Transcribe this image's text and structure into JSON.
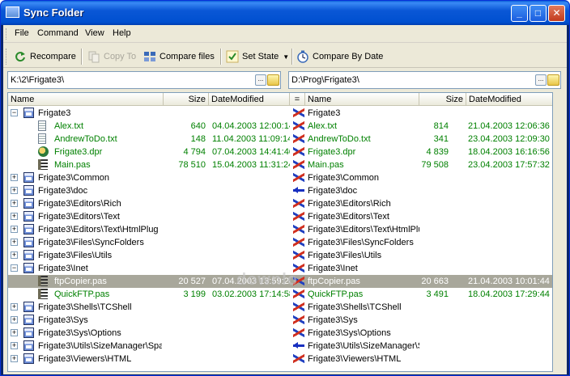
{
  "window": {
    "title": "Sync Folder",
    "buttons": {
      "minimize": "_",
      "maximize": "□",
      "close": "✕"
    }
  },
  "menu": [
    "File",
    "Command",
    "View",
    "Help"
  ],
  "toolbar": {
    "recompare": "Recompare",
    "copy_to": "Copy To",
    "compare_files": "Compare files",
    "set_state": "Set State",
    "compare_by_date": "Compare By Date"
  },
  "left_path": "K:\\2\\Frigate3\\",
  "right_path": "D:\\Prog\\Frigate3\\",
  "path_button": "...",
  "columns": {
    "left_name": "Name",
    "left_size": "Size",
    "left_date": "DateModified",
    "state": "=",
    "right_name": "Name",
    "right_size": "Size",
    "right_date": "DateModified"
  },
  "rows": [
    {
      "level": 0,
      "exp": "−",
      "icon": "dir",
      "name": "Frigate3",
      "size": "",
      "date": "",
      "sync": "swap",
      "rname": "Frigate3",
      "rsize": "",
      "rdate": "",
      "green": false,
      "sel": false
    },
    {
      "level": 1,
      "exp": "",
      "icon": "txt",
      "name": "Alex.txt",
      "size": "640",
      "date": "04.04.2003 12:00:14",
      "sync": "swap",
      "rname": "Alex.txt",
      "rsize": "814",
      "rdate": "21.04.2003 12:06:36",
      "green": true,
      "sel": false
    },
    {
      "level": 1,
      "exp": "",
      "icon": "txt",
      "name": "AndrewToDo.txt",
      "size": "148",
      "date": "11.04.2003 11:09:14",
      "sync": "swap",
      "rname": "AndrewToDo.txt",
      "rsize": "341",
      "rdate": "23.04.2003 12:09:30",
      "green": true,
      "sel": false
    },
    {
      "level": 1,
      "exp": "",
      "icon": "dpr",
      "name": "Frigate3.dpr",
      "size": "4 794",
      "date": "07.04.2003 14:41:46",
      "sync": "swap",
      "rname": "Frigate3.dpr",
      "rsize": "4 839",
      "rdate": "18.04.2003 16:16:56",
      "green": true,
      "sel": false
    },
    {
      "level": 1,
      "exp": "",
      "icon": "pas",
      "name": "Main.pas",
      "size": "78 510",
      "date": "15.04.2003 11:31:24",
      "sync": "swap",
      "rname": "Main.pas",
      "rsize": "79 508",
      "rdate": "23.04.2003 17:57:32",
      "green": true,
      "sel": false
    },
    {
      "level": 0,
      "exp": "+",
      "icon": "dir",
      "name": "Frigate3\\Common",
      "size": "",
      "date": "",
      "sync": "swap",
      "rname": "Frigate3\\Common",
      "rsize": "",
      "rdate": "",
      "green": false,
      "sel": false
    },
    {
      "level": 0,
      "exp": "+",
      "icon": "dir",
      "name": "Frigate3\\doc",
      "size": "",
      "date": "",
      "sync": "left",
      "rname": "Frigate3\\doc",
      "rsize": "",
      "rdate": "",
      "green": false,
      "sel": false
    },
    {
      "level": 0,
      "exp": "+",
      "icon": "dir",
      "name": "Frigate3\\Editors\\Rich",
      "size": "",
      "date": "",
      "sync": "swap",
      "rname": "Frigate3\\Editors\\Rich",
      "rsize": "",
      "rdate": "",
      "green": false,
      "sel": false
    },
    {
      "level": 0,
      "exp": "+",
      "icon": "dir",
      "name": "Frigate3\\Editors\\Text",
      "size": "",
      "date": "",
      "sync": "swap",
      "rname": "Frigate3\\Editors\\Text",
      "rsize": "",
      "rdate": "",
      "green": false,
      "sel": false
    },
    {
      "level": 0,
      "exp": "+",
      "icon": "dir",
      "name": "Frigate3\\Editors\\Text\\HtmlPlug",
      "size": "",
      "date": "",
      "sync": "swap",
      "rname": "Frigate3\\Editors\\Text\\HtmlPlug",
      "rsize": "",
      "rdate": "",
      "green": false,
      "sel": false
    },
    {
      "level": 0,
      "exp": "+",
      "icon": "dir",
      "name": "Frigate3\\Files\\SyncFolders",
      "size": "",
      "date": "",
      "sync": "swap",
      "rname": "Frigate3\\Files\\SyncFolders",
      "rsize": "",
      "rdate": "",
      "green": false,
      "sel": false
    },
    {
      "level": 0,
      "exp": "+",
      "icon": "dir",
      "name": "Frigate3\\Files\\Utils",
      "size": "",
      "date": "",
      "sync": "swap",
      "rname": "Frigate3\\Files\\Utils",
      "rsize": "",
      "rdate": "",
      "green": false,
      "sel": false
    },
    {
      "level": 0,
      "exp": "−",
      "icon": "dir",
      "name": "Frigate3\\Inet",
      "size": "",
      "date": "",
      "sync": "swap",
      "rname": "Frigate3\\Inet",
      "rsize": "",
      "rdate": "",
      "green": false,
      "sel": false
    },
    {
      "level": 1,
      "exp": "",
      "icon": "pas",
      "name": "ftpCopier.pas",
      "size": "20 527",
      "date": "07.04.2003 13:59:24",
      "sync": "swap",
      "rname": "ftpCopier.pas",
      "rsize": "20 663",
      "rdate": "21.04.2003 10:01:44",
      "green": true,
      "sel": true
    },
    {
      "level": 1,
      "exp": "",
      "icon": "pas",
      "name": "QuickFTP.pas",
      "size": "3 199",
      "date": "03.02.2003 17:14:58",
      "sync": "swap",
      "rname": "QuickFTP.pas",
      "rsize": "3 491",
      "rdate": "18.04.2003 17:29:44",
      "green": true,
      "sel": false
    },
    {
      "level": 0,
      "exp": "+",
      "icon": "dir",
      "name": "Frigate3\\Shells\\TCShell",
      "size": "",
      "date": "",
      "sync": "swap",
      "rname": "Frigate3\\Shells\\TCShell",
      "rsize": "",
      "rdate": "",
      "green": false,
      "sel": false
    },
    {
      "level": 0,
      "exp": "+",
      "icon": "dir",
      "name": "Frigate3\\Sys",
      "size": "",
      "date": "",
      "sync": "swap",
      "rname": "Frigate3\\Sys",
      "rsize": "",
      "rdate": "",
      "green": false,
      "sel": false
    },
    {
      "level": 0,
      "exp": "+",
      "icon": "dir",
      "name": "Frigate3\\Sys\\Options",
      "size": "",
      "date": "",
      "sync": "swap",
      "rname": "Frigate3\\Sys\\Options",
      "rsize": "",
      "rdate": "",
      "green": false,
      "sel": false
    },
    {
      "level": 0,
      "exp": "+",
      "icon": "dir",
      "name": "Frigate3\\Utils\\SizeManager\\Spa",
      "size": "",
      "date": "",
      "sync": "left",
      "rname": "Frigate3\\Utils\\SizeManager\\S",
      "rsize": "",
      "rdate": "",
      "green": false,
      "sel": false
    },
    {
      "level": 0,
      "exp": "+",
      "icon": "dir",
      "name": "Frigate3\\Viewers\\HTML",
      "size": "",
      "date": "",
      "sync": "swap",
      "rname": "Frigate3\\Viewers\\HTML",
      "rsize": "",
      "rdate": "",
      "green": false,
      "sel": false
    }
  ],
  "watermark": "downlo",
  "scroll": {
    "up": "▲",
    "down": "▼"
  },
  "colors": {
    "changed": "#008000",
    "selected_row": "#a8a79b",
    "title_bar": "#0a57d6"
  }
}
